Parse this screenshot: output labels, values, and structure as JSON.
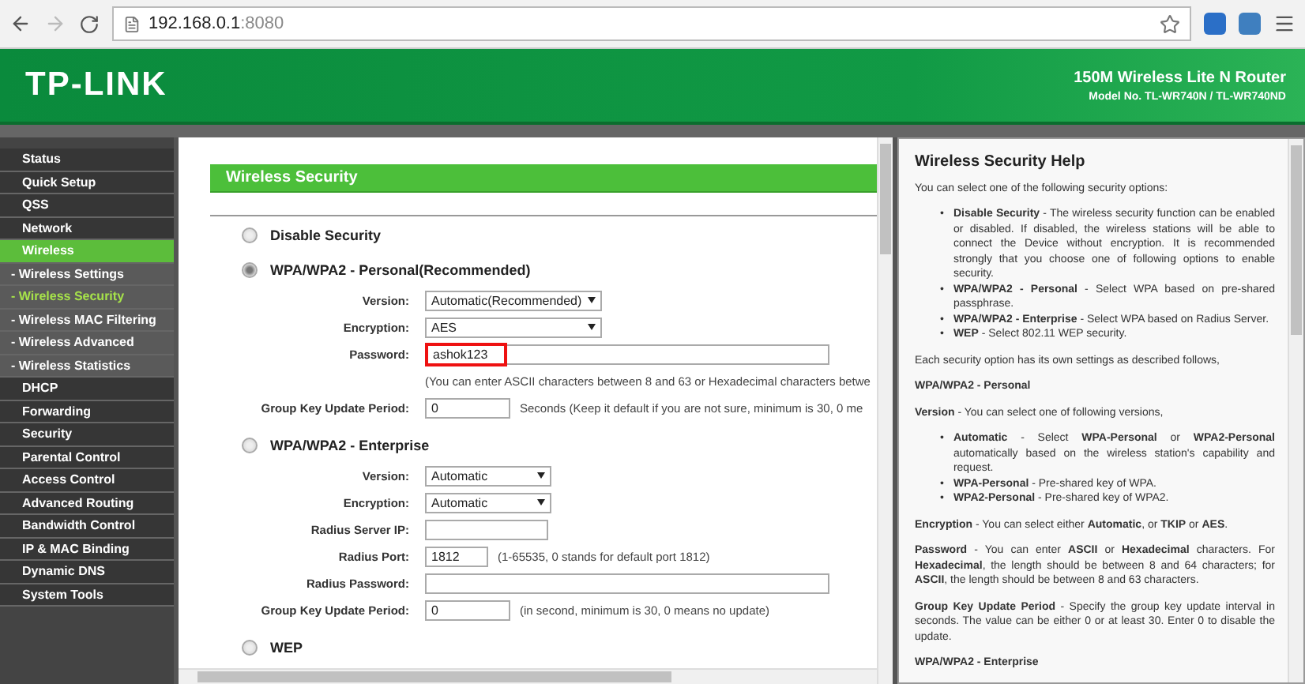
{
  "browser": {
    "url_host": "192.168.0.1",
    "url_port": ":8080"
  },
  "header": {
    "brand": "TP-LINK",
    "product": "150M Wireless Lite N Router",
    "model": "Model No. TL-WR740N / TL-WR740ND"
  },
  "sidebar": {
    "items": [
      {
        "label": "Status",
        "selected": false
      },
      {
        "label": "Quick Setup",
        "selected": false
      },
      {
        "label": "QSS",
        "selected": false
      },
      {
        "label": "Network",
        "selected": false
      },
      {
        "label": "Wireless",
        "selected": true,
        "children": [
          {
            "label": "- Wireless Settings",
            "selected": false
          },
          {
            "label": "- Wireless Security",
            "selected": true
          },
          {
            "label": "- Wireless MAC Filtering",
            "selected": false
          },
          {
            "label": "- Wireless Advanced",
            "selected": false
          },
          {
            "label": "- Wireless Statistics",
            "selected": false
          }
        ]
      },
      {
        "label": "DHCP",
        "selected": false
      },
      {
        "label": "Forwarding",
        "selected": false
      },
      {
        "label": "Security",
        "selected": false
      },
      {
        "label": "Parental Control",
        "selected": false
      },
      {
        "label": "Access Control",
        "selected": false
      },
      {
        "label": "Advanced Routing",
        "selected": false
      },
      {
        "label": "Bandwidth Control",
        "selected": false
      },
      {
        "label": "IP & MAC Binding",
        "selected": false
      },
      {
        "label": "Dynamic DNS",
        "selected": false
      },
      {
        "label": "System Tools",
        "selected": false
      }
    ]
  },
  "main": {
    "title": "Wireless Security",
    "options": [
      {
        "label": "Disable Security",
        "selected": false
      },
      {
        "label": "WPA/WPA2 - Personal(Recommended)",
        "selected": true,
        "fields": [
          {
            "kind": "select-wide",
            "label": "Version:",
            "value": "Automatic(Recommended)"
          },
          {
            "kind": "select-wide",
            "label": "Encryption:",
            "value": "AES"
          },
          {
            "kind": "input-long",
            "label": "Password:",
            "value": "ashok123",
            "highlighted": true
          },
          {
            "kind": "note",
            "note": "(You can enter ASCII characters between 8 and 63 or Hexadecimal characters betwe"
          },
          {
            "kind": "input-short",
            "label": "Group Key Update Period:",
            "value": "0",
            "note": "Seconds (Keep it default if you are not sure, minimum is 30, 0 me"
          }
        ]
      },
      {
        "label": "WPA/WPA2 - Enterprise",
        "selected": false,
        "fields": [
          {
            "kind": "select",
            "label": "Version:",
            "value": "Automatic"
          },
          {
            "kind": "select",
            "label": "Encryption:",
            "value": "Automatic"
          },
          {
            "kind": "input-mid",
            "label": "Radius Server IP:"
          },
          {
            "kind": "input-tiny",
            "label": "Radius Port:",
            "value": "1812",
            "note": "(1-65535, 0 stands for default port 1812)"
          },
          {
            "kind": "input-long",
            "label": "Radius Password:"
          },
          {
            "kind": "input-short",
            "label": "Group Key Update Period:",
            "value": "0",
            "note": "(in second, minimum is 30, 0 means no update)"
          }
        ]
      },
      {
        "label": "WEP",
        "selected": false
      }
    ]
  },
  "help": {
    "title": "Wireless Security Help",
    "blocks": [
      {
        "kind": "para",
        "text": "You can select one of the following security options:"
      },
      {
        "kind": "list",
        "bullet": "•",
        "items": [
          "**Disable Security** - The wireless security function can be enabled or disabled. If disabled, the wireless stations will be able to connect the Device without encryption. It is recommended strongly that you choose one of following options to enable security.",
          "**WPA/WPA2 - Personal** - Select WPA based on pre-shared passphrase.",
          "**WPA/WPA2 - Enterprise** - Select WPA based on Radius Server.",
          "**WEP** - Select 802.11 WEP security."
        ]
      },
      {
        "kind": "para",
        "text": "Each security option has its own settings as described follows,"
      },
      {
        "kind": "heading",
        "text": "WPA/WPA2 - Personal"
      },
      {
        "kind": "para",
        "text": "**Version** - You can select one of following versions,"
      },
      {
        "kind": "list",
        "bullet": "•",
        "items": [
          "**Automatic** - Select **WPA-Personal** or **WPA2-Personal** automatically based on the wireless station's capability and request.",
          "**WPA-Personal** - Pre-shared key of WPA.",
          "**WPA2-Personal** - Pre-shared key of WPA2."
        ]
      },
      {
        "kind": "para",
        "text": "**Encryption** - You can select either **Automatic**, or **TKIP** or **AES**."
      },
      {
        "kind": "para",
        "text": "**Password** - You can enter **ASCII** or **Hexadecimal** characters. For **Hexadecimal**, the length should be between 8 and 64 characters; for **ASCII**, the length should be between 8 and 63 characters."
      },
      {
        "kind": "para",
        "text": "**Group Key Update Period** - Specify the group key update interval in seconds. The value can be either 0 or at least 30. Enter 0 to disable the update."
      },
      {
        "kind": "heading",
        "text": "WPA/WPA2 - Enterprise"
      }
    ]
  }
}
